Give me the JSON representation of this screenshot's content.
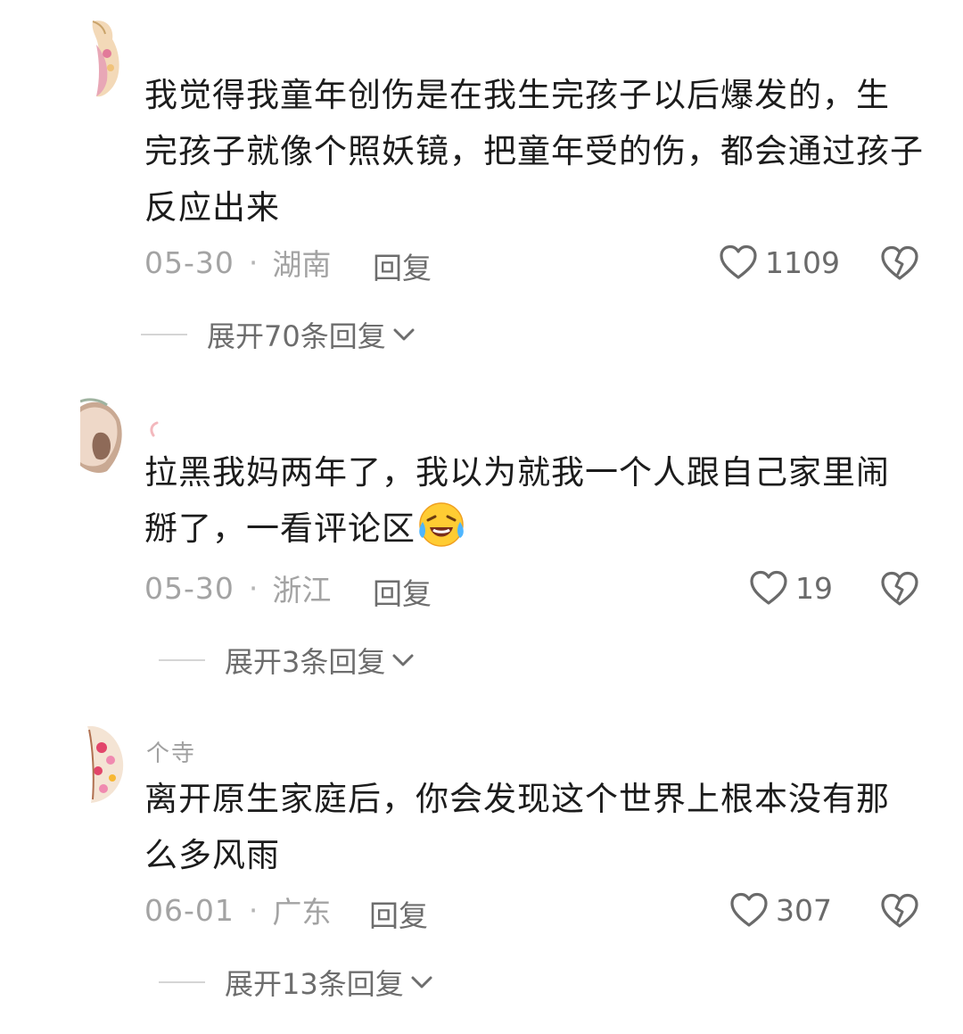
{
  "comments": [
    {
      "username": "",
      "text_lines": [
        "我觉得我童年创伤是在我生完孩子以后爆发的，生",
        "完孩子就像个照妖镜，把童年受的伤，都会通过孩子",
        "反应出来"
      ],
      "date": "05-30",
      "location": "湖南",
      "reply_label": "回复",
      "likes": "1109",
      "expand_label": "展开70条回复"
    },
    {
      "username": "",
      "text_lines": [
        "拉黑我妈两年了，我以为就我一个人跟自己家里闹",
        "掰了，一看评论区"
      ],
      "emoji": "crying-laughing-emoji",
      "date": "05-30",
      "location": "浙江",
      "reply_label": "回复",
      "likes": "19",
      "expand_label": "展开3条回复"
    },
    {
      "username": "个寺",
      "text_lines": [
        "离开原生家庭后，你会发现这个世界上根本没有那",
        "么多风雨"
      ],
      "date": "06-01",
      "location": "广东",
      "reply_label": "回复",
      "likes": "307",
      "expand_label": "展开13条回复"
    }
  ],
  "separator": "·",
  "icons": {
    "like": "heart-outline-icon",
    "dislike": "broken-heart-icon",
    "expand": "chevron-down-icon"
  },
  "colors": {
    "text": "#1c1c1c",
    "muted": "#a3a3a3",
    "action": "#6d6d6d"
  }
}
